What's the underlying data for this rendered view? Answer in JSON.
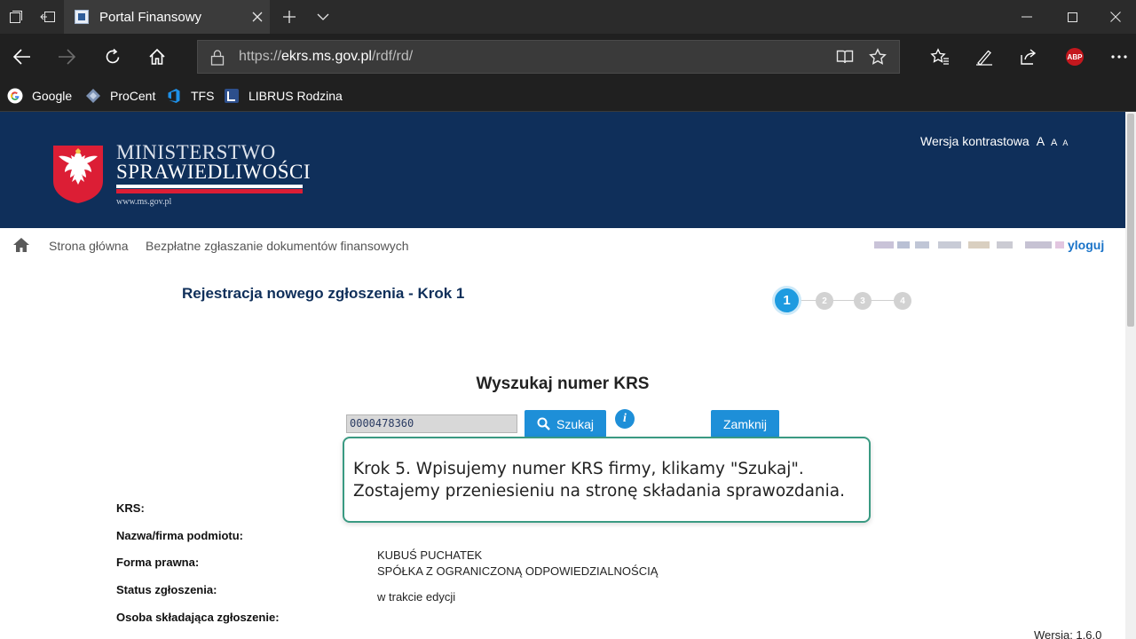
{
  "browser": {
    "tab": {
      "title": "Portal Finansowy"
    },
    "address": {
      "scheme": "https://",
      "host": "ekrs.ms.gov.pl",
      "path": "/rdf/rd/"
    },
    "favorites": [
      {
        "label": "Google",
        "icon": "google-icon"
      },
      {
        "label": "ProCent",
        "icon": "procent-icon"
      },
      {
        "label": "TFS",
        "icon": "tfs-icon"
      },
      {
        "label": "LIBRUS Rodzina",
        "icon": "librus-icon"
      }
    ],
    "adblock_label": "ABP"
  },
  "header": {
    "logo_line1": "MINISTERSTWO",
    "logo_line2": "SPRAWIEDLIWOŚCI",
    "logo_url": "www.ms.gov.pl",
    "contrast_label": "Wersja kontrastowa",
    "font_size_labels": [
      "A",
      "A",
      "A"
    ],
    "colors": {
      "navy": "#0f2f5a",
      "red": "#dc1e35"
    }
  },
  "breadcrumb": {
    "items": [
      "Strona główna",
      "Bezpłatne zgłaszanie dokumentów finansowych"
    ],
    "logout": "yloguj"
  },
  "main": {
    "heading": "Rejestracja nowego zgłoszenia - Krok 1",
    "steps": [
      "1",
      "2",
      "3",
      "4"
    ],
    "active_step": 1,
    "search_title": "Wyszukaj numer KRS",
    "krs_value": "0000478360",
    "search_button": "Szukaj",
    "info_label": "i",
    "close_button": "Zamknij",
    "labels": {
      "krs": "KRS:",
      "name": "Nazwa/firma podmiotu:",
      "legal_form": "Forma prawna:",
      "status": "Status zgłoszenia:",
      "submitter": "Osoba składająca zgłoszenie:"
    },
    "values": {
      "name": "KUBUŚ PUCHATEK",
      "legal_form": "SPÓŁKA Z OGRANICZONĄ ODPOWIEDZIALNOŚCIĄ",
      "status": "w trakcie edycji"
    },
    "version": "Wersja: 1.6.0"
  },
  "tooltip": {
    "line1": "Krok 5. Wpisujemy numer KRS firmy, klikamy \"Szukaj\".",
    "line2": "Zostajemy przeniesieniu na stronę składania sprawozdania."
  }
}
